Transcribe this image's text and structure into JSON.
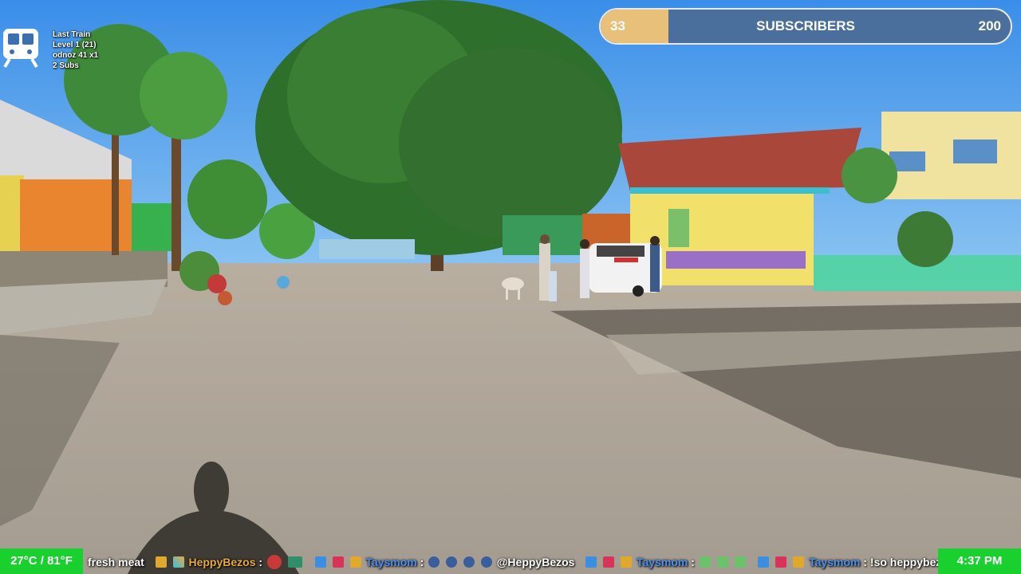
{
  "train": {
    "icon": "train-icon",
    "name": "Last Train",
    "level": "Level 1  (21)",
    "user": "odnoz 41 x1",
    "subs": "2 Subs"
  },
  "subscribers": {
    "current": "33",
    "label": "SUBSCRIBERS",
    "target": "200",
    "progress_fraction": 0.165,
    "fill_color": "#e9c07a",
    "bar_color": "#4b6f9c"
  },
  "weather": "27°C / 81°F",
  "clock": "4:37 PM",
  "ticker": {
    "msg1_text": "fresh meat",
    "msg2_user": "HeppyBezos",
    "msg3_user": "Taysmom",
    "msg3_text": "@HeppyBezos",
    "msg4_user": "Taysmom",
    "msg5_user": "Taysmom",
    "msg5_text": "!so heppybezos",
    "colon": ":",
    "accent_green": "#19d02f"
  }
}
